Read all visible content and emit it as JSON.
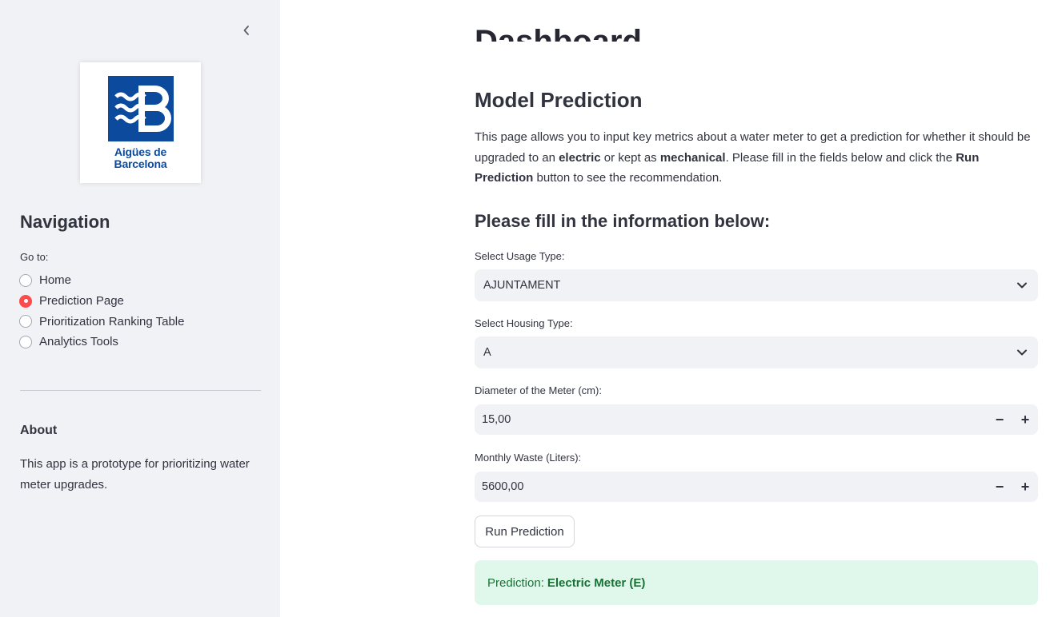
{
  "sidebar": {
    "logo_text_line1": "Aigües de",
    "logo_text_line2": "Barcelona",
    "nav_title": "Navigation",
    "goto_label": "Go to:",
    "nav_items": [
      {
        "label": "Home",
        "selected": false
      },
      {
        "label": "Prediction Page",
        "selected": true
      },
      {
        "label": "Prioritization Ranking Table",
        "selected": false
      },
      {
        "label": "Analytics Tools",
        "selected": false
      }
    ],
    "about_title": "About",
    "about_text": "This app is a prototype for prioritizing water meter upgrades."
  },
  "main": {
    "page_title": "Dashboard",
    "section_title": "Model Prediction",
    "description": {
      "part1": "This page allows you to input key metrics about a water meter to get a prediction for whether it should be upgraded to an ",
      "bold1": "electric",
      "part2": " or kept as ",
      "bold2": "mechanical",
      "part3": ". Please fill in the fields below and click the ",
      "bold3": "Run Prediction",
      "part4": " button to see the recommendation."
    },
    "form_title": "Please fill in the information below:",
    "usage_type": {
      "label": "Select Usage Type:",
      "value": "AJUNTAMENT"
    },
    "housing_type": {
      "label": "Select Housing Type:",
      "value": "A"
    },
    "diameter": {
      "label": "Diameter of the Meter (cm):",
      "value": "15,00"
    },
    "monthly_waste": {
      "label": "Monthly Waste (Liters):",
      "value": "5600,00"
    },
    "stepper_minus": "−",
    "stepper_plus": "+",
    "run_button": "Run Prediction",
    "result": {
      "prefix": "Prediction:",
      "value": "Electric Meter (E)"
    }
  },
  "colors": {
    "sidebar_bg": "#f0f2f6",
    "accent": "#ff4b4b",
    "logo_blue": "#0b4a9c",
    "success_bg": "#e0f8ec",
    "success_text": "#177233"
  },
  "icons": {
    "collapse": "chevron-left-icon",
    "select": "chevron-down-icon"
  }
}
